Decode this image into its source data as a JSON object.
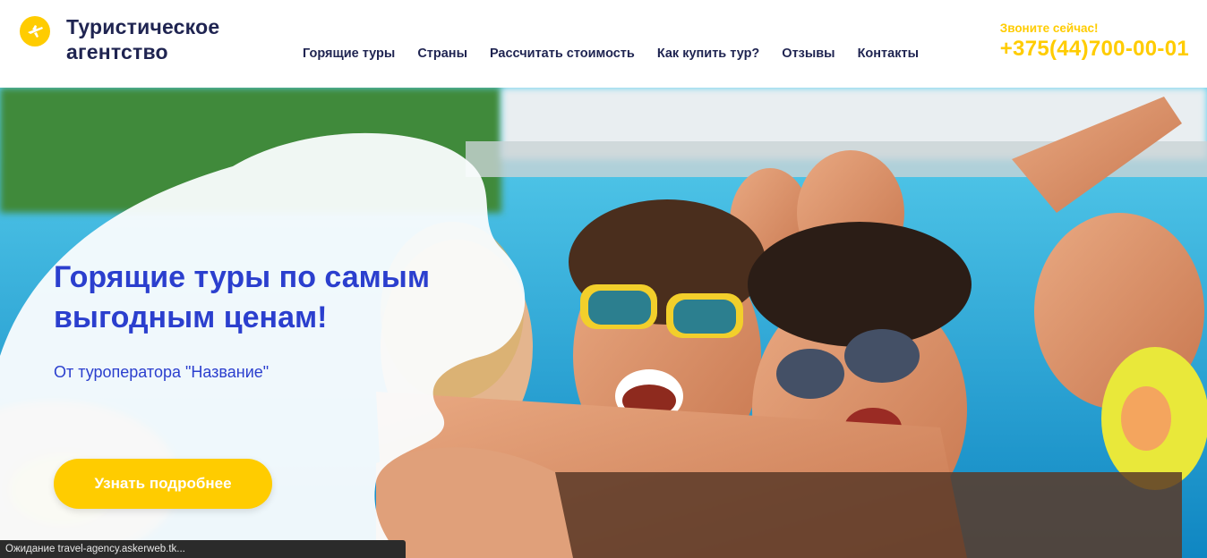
{
  "header": {
    "logo_line1": "Туристическое",
    "logo_line2": "агентство",
    "logo_icon": "airplane-icon",
    "nav": [
      "Горящие туры",
      "Страны",
      "Рассчитать стоимость",
      "Как купить тур?",
      "Отзывы",
      "Контакты"
    ],
    "call_label": "Звоните сейчас!",
    "phone": "+375(44)700-00-01"
  },
  "hero": {
    "title": "Горящие туры по самым выгодным ценам!",
    "subtitle": "От туроператора \"Название\"",
    "cta_label": "Узнать подробнее"
  },
  "status_bar": {
    "text": "Ожидание travel-agency.askerweb.tk..."
  },
  "colors": {
    "brand_dark": "#1f2451",
    "accent_yellow": "#ffcc00",
    "hero_text_blue": "#2b3fce",
    "pool_blue": "#1ea5d6"
  }
}
